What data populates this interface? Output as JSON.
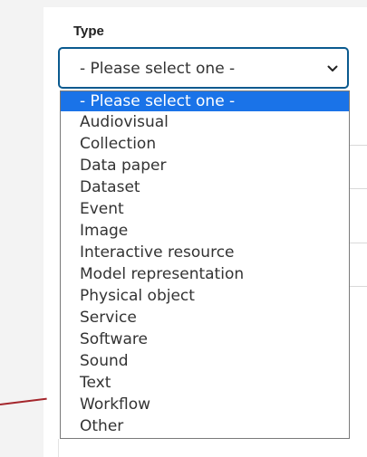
{
  "field": {
    "label": "Type",
    "selected_value": "- Please select one -"
  },
  "dropdown": {
    "options": [
      "- Please select one -",
      "Audiovisual",
      "Collection",
      "Data paper",
      "Dataset",
      "Event",
      "Image",
      "Interactive resource",
      "Model representation",
      "Physical object",
      "Service",
      "Software",
      "Sound",
      "Text",
      "Workflow",
      "Other"
    ],
    "highlighted_index": 0
  },
  "colors": {
    "focus_border": "#0a5a8f",
    "highlight": "#1a73e8",
    "text": "#333333",
    "annotation_line": "#a4262c"
  },
  "icons": {
    "select_arrow": "chevron-down-icon"
  }
}
